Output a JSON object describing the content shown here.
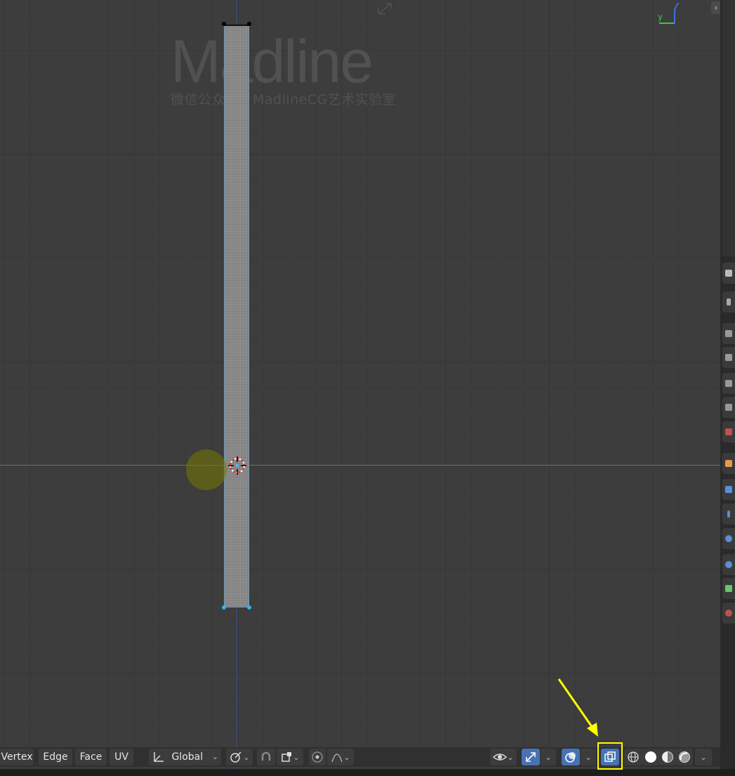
{
  "watermark": {
    "logo_text": "Madline",
    "subtitle": "微信公众号：MadlineCG艺术实验室"
  },
  "gizmo": {
    "y_label": "y"
  },
  "collapse_arrow": "‹",
  "header": {
    "select_modes": [
      "Vertex",
      "Edge",
      "Face",
      "UV"
    ],
    "orientation_label": "Global",
    "caret": "⌄"
  },
  "colors": {
    "viewport_bg": "#3d3d3d",
    "y_axis": "#4d8f3a",
    "z_axis": "#3b4fa6",
    "selected_vertex": "#29b6f6",
    "active_button": "#4772b3",
    "annotation": "#ffff00"
  },
  "icons": {
    "transform_orientation": "orientation-icon",
    "pivot": "pivot-icon",
    "snap": "snap-magnet-icon",
    "snap_target": "snap-target-icon",
    "proportional": "proportional-edit-icon",
    "falloff": "falloff-curve-icon",
    "visibility": "eye-icon",
    "gizmo": "gizmo-arrows-icon",
    "overlay": "overlay-icon",
    "xray": "xray-toggle-icon",
    "wireframe": "wireframe-shading-icon",
    "solid": "solid-shading-icon",
    "material": "material-shading-icon",
    "rendered": "rendered-shading-icon"
  }
}
